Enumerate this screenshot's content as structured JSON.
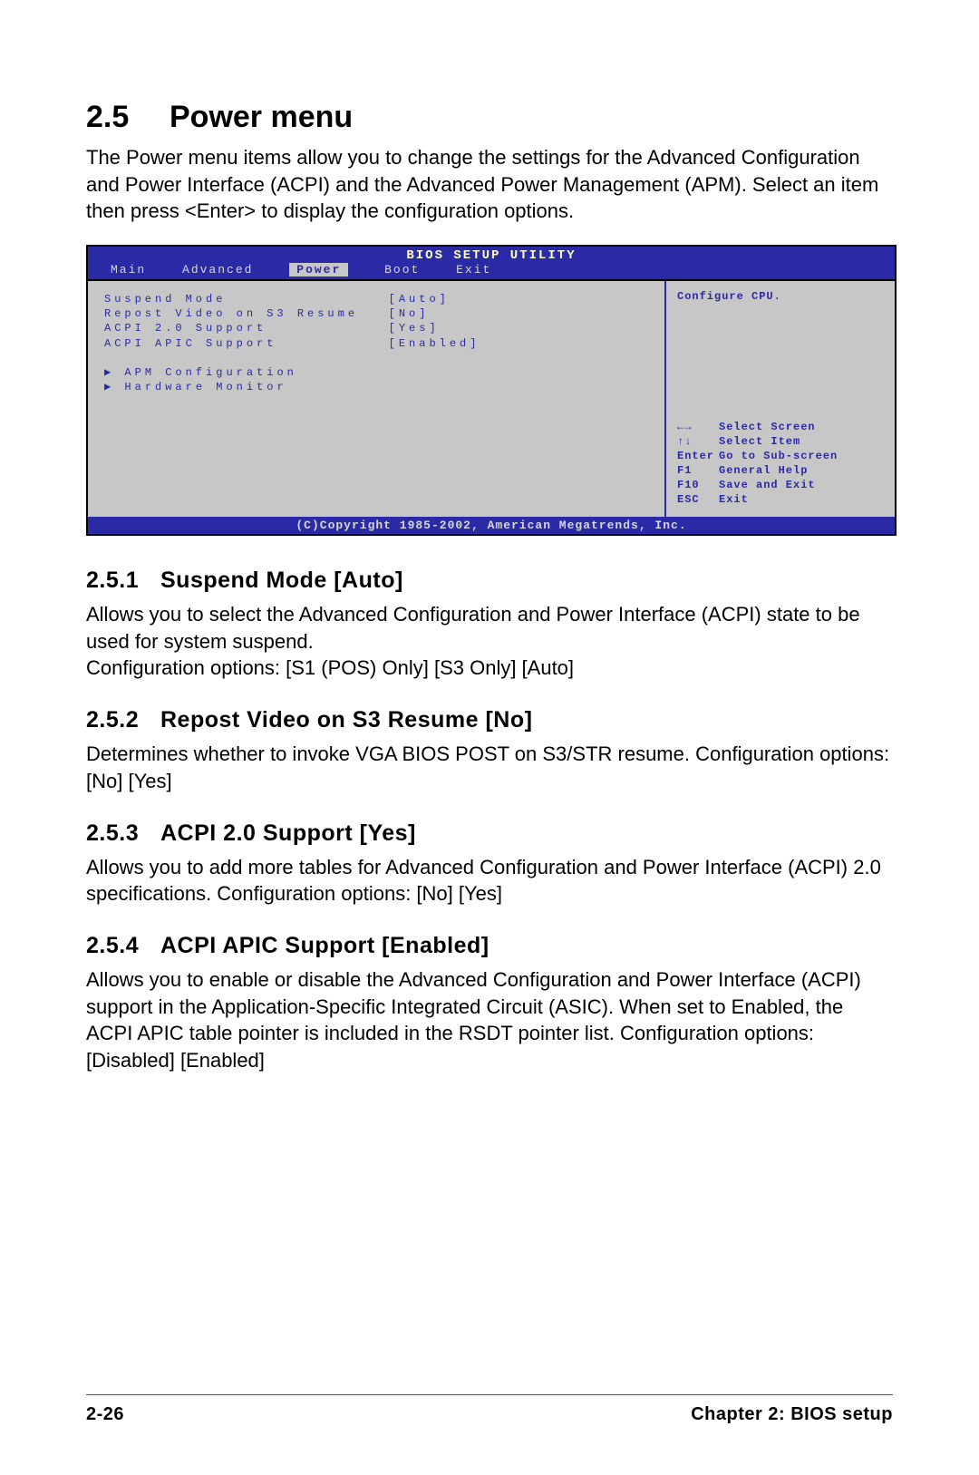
{
  "header": {
    "number": "2.5",
    "title": "Power menu",
    "intro": "The Power menu items allow you to change the settings for the Advanced Configuration and Power Interface (ACPI) and the Advanced Power Management (APM). Select an item then press <Enter> to display the configuration options."
  },
  "bios": {
    "title": "BIOS SETUP UTILITY",
    "menu": [
      "Main",
      "Advanced",
      "Power",
      "Boot",
      "Exit"
    ],
    "activeMenuIndex": 2,
    "items": [
      {
        "label": "Suspend Mode",
        "value": "[Auto]"
      },
      {
        "label": "Repost Video on S3 Resume",
        "value": "[No]"
      },
      {
        "label": "ACPI 2.0 Support",
        "value": "[Yes]"
      },
      {
        "label": "ACPI APIC Support",
        "value": "[Enabled]"
      }
    ],
    "submenus": [
      "APM Configuration",
      "Hardware Monitor"
    ],
    "helpText": "Configure CPU.",
    "keys": [
      {
        "key": "←→",
        "action": "Select Screen"
      },
      {
        "key": "↑↓",
        "action": "Select Item"
      },
      {
        "key": "Enter",
        "action": "Go to Sub-screen"
      },
      {
        "key": "F1",
        "action": "General Help"
      },
      {
        "key": "F10",
        "action": "Save and Exit"
      },
      {
        "key": "ESC",
        "action": "Exit"
      }
    ],
    "copyright": "(C)Copyright 1985-2002, American Megatrends, Inc."
  },
  "sections": [
    {
      "number": "2.5.1",
      "title": "Suspend Mode [Auto]",
      "body": "Allows you to select the Advanced Configuration and Power Interface (ACPI) state to be used for system suspend.\nConfiguration options: [S1 (POS) Only] [S3 Only] [Auto]"
    },
    {
      "number": "2.5.2",
      "title": "Repost Video on S3 Resume [No]",
      "body": "Determines whether to invoke VGA BIOS POST on S3/STR resume. Configuration options: [No] [Yes]"
    },
    {
      "number": "2.5.3",
      "title": "ACPI 2.0 Support [Yes]",
      "body": "Allows you to add more tables for Advanced Configuration and Power Interface (ACPI) 2.0 specifications. Configuration options: [No] [Yes]"
    },
    {
      "number": "2.5.4",
      "title": "ACPI APIC Support [Enabled]",
      "body": "Allows you to enable or disable the Advanced Configuration and Power Interface (ACPI) support in the Application-Specific Integrated Circuit (ASIC). When set to Enabled, the ACPI APIC table pointer is included in the RSDT pointer list. Configuration options: [Disabled] [Enabled]"
    }
  ],
  "footer": {
    "left": "2-26",
    "right": "Chapter 2: BIOS setup"
  }
}
